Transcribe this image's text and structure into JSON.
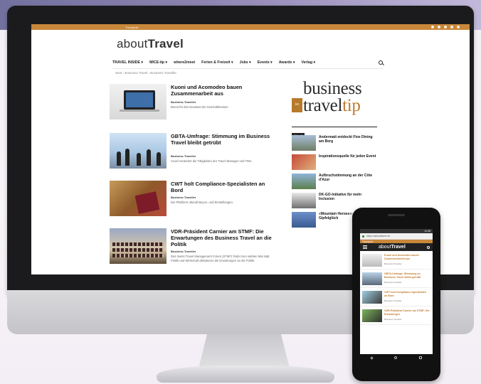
{
  "site": {
    "topbar_link": "Travelpost",
    "logo_light": "about",
    "logo_bold": "Travel",
    "nav": [
      "TRAVEL INSIDE ▾",
      "MICE-tip ▾",
      "where2meet",
      "Ferien & Freizeit ▾",
      "Jobs ▾",
      "Events ▾",
      "Awards ▾",
      "Verlag ▾"
    ],
    "breadcrumb": "Start  ›  Business Travel  ›  Business Traveller"
  },
  "articles": [
    {
      "title": "Kuoni und Acomodeo bauen Zusammenarbeit aus",
      "author": "Business Traveller",
      "excerpt": "Bereit für den Neustart der Geschäftsreisen"
    },
    {
      "title": "GBTA-Umfrage: Stimmung im Business Travel bleibt getrübt",
      "author": "Business Traveller",
      "excerpt": "Covid verändert die Tätigkeiten der Travel Manager und TMC."
    },
    {
      "title": "CWT holt Compliance-Spezialisten an Bord",
      "author": "Business Traveller",
      "excerpt": "Die Plattform überall Beyon- und Einstellungen."
    },
    {
      "title": "VDR-Präsident Carnier am STMF: Die Erwartungen des Business Travel an die Politik",
      "author": "Business Traveller",
      "excerpt": "Das Swiss Travel Management Forum (STMF) findet zum siebten Mal statt. Politik und Wirtschaft diskutieren die Erwartungen an die Politik."
    }
  ],
  "sidebar": {
    "logo_line1": "business",
    "logo_line2a": "travel",
    "logo_line2b": "tip",
    "logo_box": "btt",
    "section_label": "Aktuell",
    "items": [
      {
        "title": "Andermatt entdeckt Fine Dining am Berg"
      },
      {
        "title": "Inspirationsquelle für jeden Event"
      },
      {
        "title": "Aufbruchstimmung an der Côte d'Azur"
      },
      {
        "title": "DK-GO-Initiative für mehr Inclusion"
      },
      {
        "title": "«Mountain Heroes»: Erlebnis im Gipfelglück"
      }
    ]
  },
  "phone": {
    "time": "11:28",
    "url": "https://abouttravel.ch",
    "topbar_link": "Travelpost",
    "logo_light": "about",
    "logo_bold": "Travel",
    "items": [
      {
        "title": "Kuoni und Acomodeo bauen Zusammenarbeit aus",
        "author": "Business Traveller"
      },
      {
        "title": "GBTA-Umfrage: Stimmung im Business Travel bleibt getrübt",
        "author": "Business Traveller"
      },
      {
        "title": "CWT holt Compliance-Spezialisten an Bord",
        "author": "Business Traveller"
      },
      {
        "title": "VDR-Präsident Carnier am STMF: Die Erwartungen",
        "author": "Business Traveller"
      }
    ]
  }
}
